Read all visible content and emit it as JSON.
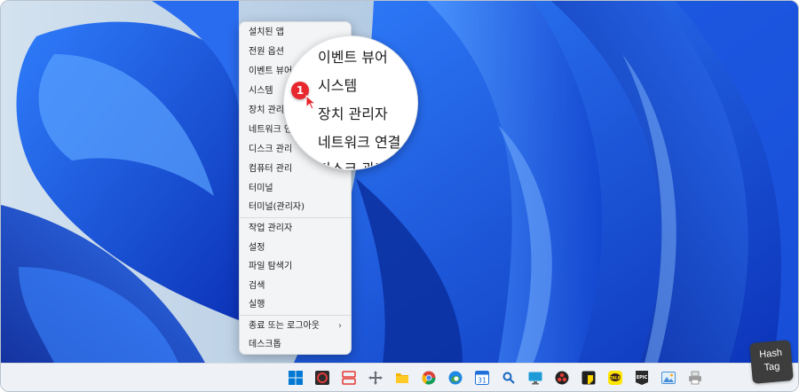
{
  "context_menu": {
    "items": [
      {
        "label": "설치된 앱"
      },
      {
        "label": "전원 옵션"
      },
      {
        "label": "이벤트 뷰어"
      },
      {
        "label": "시스템"
      },
      {
        "label": "장치 관리자"
      },
      {
        "label": "네트워크 연결"
      },
      {
        "label": "디스크 관리"
      },
      {
        "label": "컴퓨터 관리"
      },
      {
        "label": "터미널"
      },
      {
        "label": "터미널(관리자)"
      },
      {
        "label": "작업 관리자"
      },
      {
        "label": "설정"
      },
      {
        "label": "파일 탐색기"
      },
      {
        "label": "검색"
      },
      {
        "label": "실행"
      },
      {
        "label": "종료 또는 로그아웃",
        "submenu_arrow": "›"
      },
      {
        "label": "데스크톱"
      }
    ]
  },
  "magnifier": {
    "lines": [
      "이벤트 뷰어",
      "시스템",
      "장치 관리자",
      "네트워크 연결",
      "디스크 관리"
    ]
  },
  "step_badge": "1",
  "taskbar": {
    "icons": [
      "windows-start",
      "obs-studio",
      "snipping-tool",
      "move-tool",
      "file-explorer",
      "chrome",
      "edge",
      "calendar",
      "search",
      "monitor",
      "davinci",
      "sticky-notes",
      "kakaotalk",
      "epic-games",
      "photos",
      "printer"
    ],
    "calendar_day": "31",
    "kakao_text": "TALK",
    "epic_text": "EPIC"
  },
  "watermark": {
    "line1": "Hash",
    "line2": "Tag"
  },
  "colors": {
    "accent_blue": "#1a5fe8",
    "badge_red": "#e8262e",
    "menu_bg": "#f3f4f6"
  }
}
